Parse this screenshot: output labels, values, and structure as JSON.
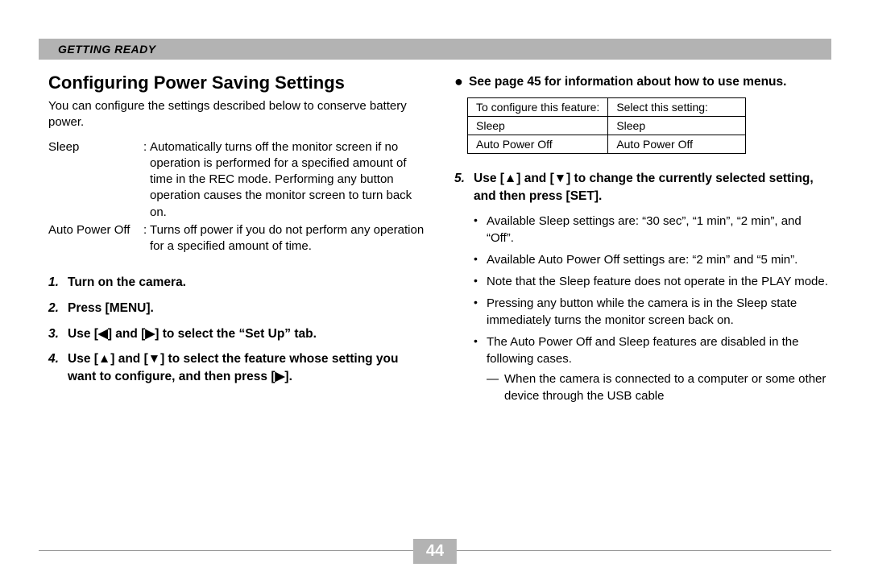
{
  "header": {
    "section": "GETTING READY"
  },
  "title": "Configuring Power Saving Settings",
  "intro": "You can configure the settings described below to conserve battery power.",
  "definitions": [
    {
      "term": "Sleep",
      "desc": "Automatically turns off the monitor screen if no operation is performed for a specified amount of time in the REC mode. Performing any button operation causes the monitor screen to turn back on."
    },
    {
      "term": "Auto Power Off",
      "desc": "Turns off power if you do not perform any operation for a specified amount of time."
    }
  ],
  "steps_left": [
    {
      "n": "1.",
      "t": "Turn on the camera."
    },
    {
      "n": "2.",
      "t": "Press [MENU]."
    },
    {
      "n": "3.",
      "t": "Use [◀] and [▶] to select the “Set Up” tab."
    },
    {
      "n": "4.",
      "t": "Use [▲] and [▼] to select the feature whose setting you want to configure, and then press [▶]."
    }
  ],
  "right": {
    "lead": "See page 45 for information about how to use menus.",
    "table": {
      "h1": "To configure this feature:",
      "h2": "Select this setting:",
      "rows": [
        [
          "Sleep",
          "Sleep"
        ],
        [
          "Auto Power Off",
          "Auto Power Off"
        ]
      ]
    },
    "step5": {
      "n": "5.",
      "t": "Use [▲] and [▼] to change the currently selected setting, and then press [SET]."
    },
    "bullets": [
      "Available Sleep settings are: “30 sec”, “1 min”, “2 min”, and “Off”.",
      "Available Auto Power Off settings are: “2 min” and “5 min”.",
      "Note that the Sleep feature does not operate in the PLAY mode.",
      "Pressing any button while the camera is in the Sleep state immediately turns the monitor screen back on.",
      "The Auto Power Off and Sleep features are disabled in the following cases."
    ],
    "subline": "When the camera is connected to a computer or some other device through the USB cable"
  },
  "page_number": "44"
}
